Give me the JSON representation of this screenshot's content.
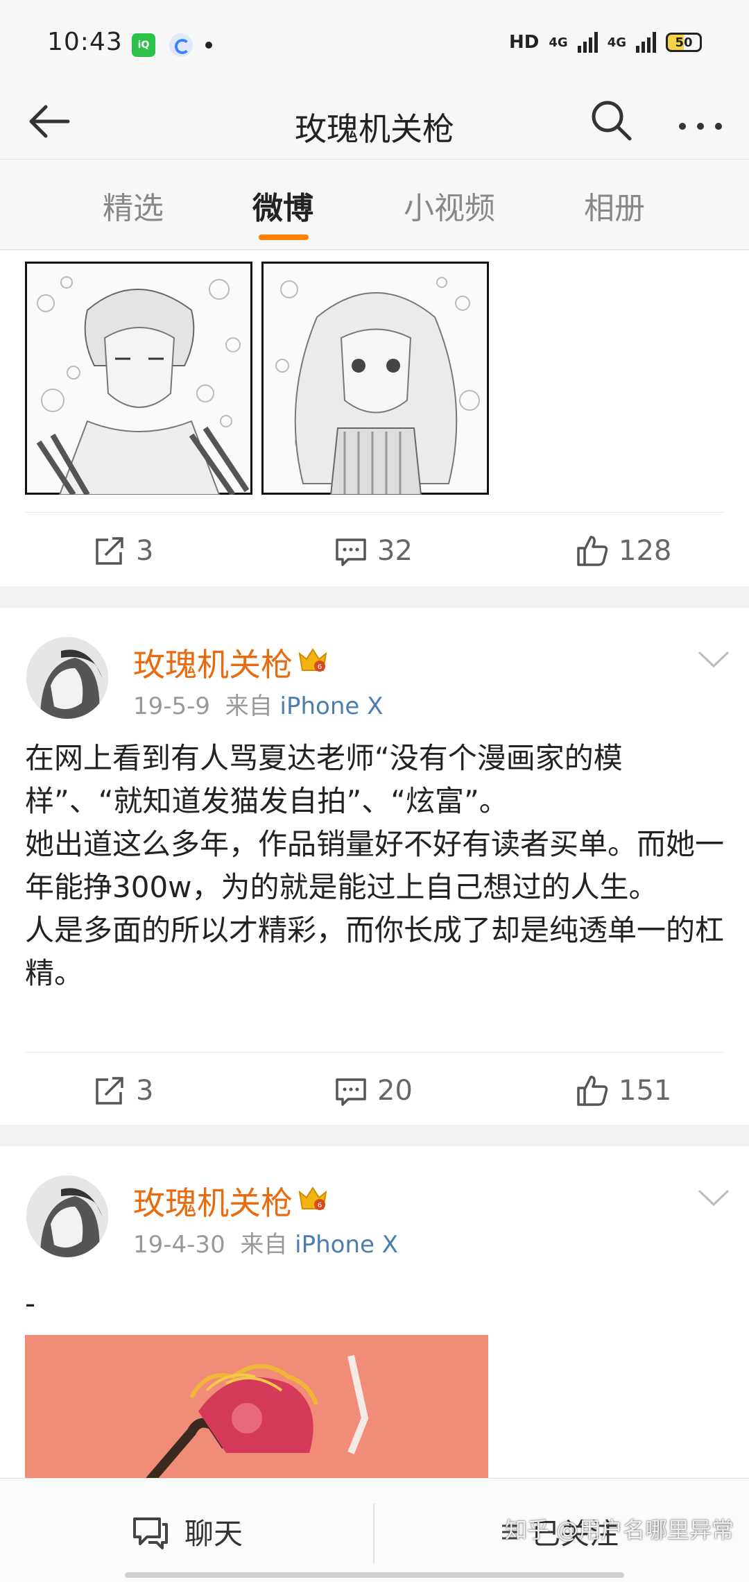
{
  "status_bar": {
    "time": "10:43",
    "app_icon_1": "iqiyi-icon",
    "app_icon_2": "browser-icon",
    "network_1": "HD",
    "network_2": "4G",
    "network_3": "4G",
    "battery": "50"
  },
  "header": {
    "title": "玫瑰机关枪",
    "back_icon": "back-arrow-icon",
    "search_icon": "search-icon",
    "more_icon": "more-icon"
  },
  "tabs": [
    {
      "label": "精选",
      "active": false
    },
    {
      "label": "微博",
      "active": true
    },
    {
      "label": "小视频",
      "active": false
    },
    {
      "label": "相册",
      "active": false
    }
  ],
  "colors": {
    "accent": "#ff8200",
    "username": "#e86b10",
    "source_link": "#4d7cae",
    "crown": "#f2b411"
  },
  "posts": [
    {
      "images": [
        "manga-boy-bubbles-image",
        "manga-girl-bubbles-image"
      ],
      "actions": {
        "repost": "3",
        "comment": "32",
        "like": "128"
      }
    },
    {
      "user": "玫瑰机关枪",
      "date": "19-5-9",
      "source_prefix": "来自",
      "source": "iPhone X",
      "text": "在网上看到有人骂夏达老师“没有个漫画家的模样”、“就知道发猫发自拍”、“炫富”。\n她出道这么多年，作品销量好不好有读者买单。而她一年能挣300w，为的就是能过上自己想过的人生。\n人是多面的所以才精彩，而你长成了却是纯透单一的杠精。",
      "actions": {
        "repost": "3",
        "comment": "20",
        "like": "151"
      }
    },
    {
      "user": "玫瑰机关枪",
      "date": "19-4-30",
      "source_prefix": "来自",
      "source": "iPhone X",
      "text": "-",
      "image": "pink-illustration-image"
    }
  ],
  "bottom_bar": {
    "chat_label": "聊天",
    "follow_label": "已关注"
  },
  "watermark": "知乎 @用户名哪里异常"
}
